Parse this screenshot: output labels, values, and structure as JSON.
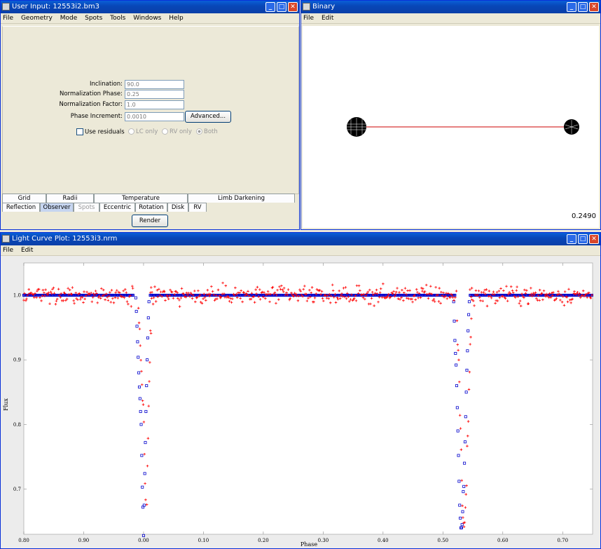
{
  "user_input": {
    "title": "User Input: 12553i2.bm3",
    "menu": [
      "File",
      "Geometry",
      "Mode",
      "Spots",
      "Tools",
      "Windows",
      "Help"
    ],
    "fields": [
      {
        "label": "Inclination:",
        "value": "90.0"
      },
      {
        "label": "Normalization Phase:",
        "value": "0.25"
      },
      {
        "label": "Normalization Factor:",
        "value": "1.0"
      },
      {
        "label": "Phase Increment:",
        "value": "0.0010"
      }
    ],
    "advanced_label": "Advanced...",
    "use_residuals": "Use residuals",
    "radio": [
      "LC only",
      "RV only",
      "Both"
    ],
    "tabs_row1": [
      "Grid",
      "Radii",
      "Temperature",
      "Limb Darkening"
    ],
    "tabs_row2": [
      "Reflection",
      "Observer",
      "Spots",
      "Eccentric",
      "Rotation",
      "Disk",
      "RV"
    ],
    "render_label": "Render"
  },
  "binary": {
    "title": "Binary",
    "menu": [
      "File",
      "Edit"
    ],
    "phase": "0.2490"
  },
  "lc": {
    "title": "Light Curve Plot: 12553i3.nrm",
    "menu": [
      "File",
      "Edit"
    ]
  },
  "chart_data": {
    "type": "scatter",
    "xlabel": "Phase",
    "ylabel": "Flux",
    "xlim": [
      -0.2,
      0.75
    ],
    "ylim": [
      0.63,
      1.05
    ],
    "x_ticks": [
      -0.2,
      -0.1,
      0.0,
      0.1,
      0.2,
      0.3,
      0.4,
      0.5,
      0.6,
      0.7
    ],
    "x_tick_labels": [
      "0.80",
      "0.90",
      "0.00",
      "0.10",
      "0.20",
      "0.30",
      "0.40",
      "0.50",
      "0.60",
      "0.70"
    ],
    "y_ticks": [
      0.7,
      0.8,
      0.9,
      1.0
    ],
    "y_tick_labels": [
      "0.7",
      "0.8",
      "0.9",
      "1.0"
    ],
    "gaps": [
      [
        -0.017,
        0.01
      ],
      [
        0.52,
        0.545
      ]
    ],
    "series": [
      {
        "marker": "plus",
        "color": "#ff0000",
        "noise": 0.013
      },
      {
        "marker": "square",
        "color": "#0000cc",
        "points": [
          [
            -0.013,
            0.996
          ],
          [
            -0.012,
            0.975
          ],
          [
            -0.011,
            0.952
          ],
          [
            -0.01,
            0.928
          ],
          [
            -0.009,
            0.904
          ],
          [
            -0.008,
            0.88
          ],
          [
            -0.007,
            0.858
          ],
          [
            -0.006,
            0.84
          ],
          [
            -0.005,
            0.82
          ],
          [
            -0.004,
            0.8
          ],
          [
            -0.003,
            0.752
          ],
          [
            -0.002,
            0.703
          ],
          [
            -0.001,
            0.672
          ],
          [
            0.0,
            0.628
          ],
          [
            0.001,
            0.675
          ],
          [
            0.002,
            0.724
          ],
          [
            0.003,
            0.772
          ],
          [
            0.004,
            0.82
          ],
          [
            0.005,
            0.86
          ],
          [
            0.006,
            0.9
          ],
          [
            0.007,
            0.934
          ],
          [
            0.008,
            0.965
          ],
          [
            0.009,
            0.99
          ],
          [
            0.518,
            0.99
          ],
          [
            0.519,
            0.96
          ],
          [
            0.52,
            0.93
          ],
          [
            0.521,
            0.91
          ],
          [
            0.522,
            0.892
          ],
          [
            0.523,
            0.86
          ],
          [
            0.524,
            0.826
          ],
          [
            0.525,
            0.79
          ],
          [
            0.526,
            0.752
          ],
          [
            0.527,
            0.712
          ],
          [
            0.528,
            0.675
          ],
          [
            0.529,
            0.655
          ],
          [
            0.53,
            0.64
          ],
          [
            0.531,
            0.64
          ],
          [
            0.532,
            0.645
          ],
          [
            0.533,
            0.665
          ],
          [
            0.534,
            0.696
          ],
          [
            0.535,
            0.704
          ],
          [
            0.536,
            0.74
          ],
          [
            0.537,
            0.773
          ],
          [
            0.538,
            0.812
          ],
          [
            0.539,
            0.85
          ],
          [
            0.54,
            0.884
          ],
          [
            0.541,
            0.914
          ],
          [
            0.542,
            0.945
          ],
          [
            0.543,
            0.97
          ],
          [
            0.544,
            0.99
          ]
        ]
      }
    ]
  }
}
